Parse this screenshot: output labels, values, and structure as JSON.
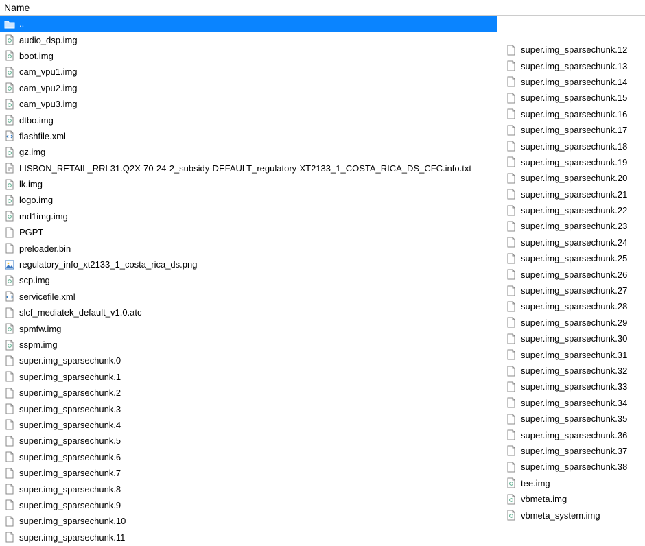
{
  "header": {
    "name_col": "Name"
  },
  "left": [
    {
      "icon": "folder-up",
      "name": "..",
      "selected": true
    },
    {
      "icon": "img",
      "name": "audio_dsp.img"
    },
    {
      "icon": "img",
      "name": "boot.img"
    },
    {
      "icon": "img",
      "name": "cam_vpu1.img"
    },
    {
      "icon": "img",
      "name": "cam_vpu2.img"
    },
    {
      "icon": "img",
      "name": "cam_vpu3.img"
    },
    {
      "icon": "img",
      "name": "dtbo.img"
    },
    {
      "icon": "xml",
      "name": "flashfile.xml"
    },
    {
      "icon": "img",
      "name": "gz.img"
    },
    {
      "icon": "txt",
      "name": "LISBON_RETAIL_RRL31.Q2X-70-24-2_subsidy-DEFAULT_regulatory-XT2133_1_COSTA_RICA_DS_CFC.info.txt"
    },
    {
      "icon": "img",
      "name": "lk.img"
    },
    {
      "icon": "img",
      "name": "logo.img"
    },
    {
      "icon": "img",
      "name": "md1img.img"
    },
    {
      "icon": "file",
      "name": "PGPT"
    },
    {
      "icon": "file",
      "name": "preloader.bin"
    },
    {
      "icon": "png",
      "name": "regulatory_info_xt2133_1_costa_rica_ds.png"
    },
    {
      "icon": "img",
      "name": "scp.img"
    },
    {
      "icon": "xml",
      "name": "servicefile.xml"
    },
    {
      "icon": "file",
      "name": "slcf_mediatek_default_v1.0.atc"
    },
    {
      "icon": "img",
      "name": "spmfw.img"
    },
    {
      "icon": "img",
      "name": "sspm.img"
    },
    {
      "icon": "file",
      "name": "super.img_sparsechunk.0"
    },
    {
      "icon": "file",
      "name": "super.img_sparsechunk.1"
    },
    {
      "icon": "file",
      "name": "super.img_sparsechunk.2"
    },
    {
      "icon": "file",
      "name": "super.img_sparsechunk.3"
    },
    {
      "icon": "file",
      "name": "super.img_sparsechunk.4"
    },
    {
      "icon": "file",
      "name": "super.img_sparsechunk.5"
    },
    {
      "icon": "file",
      "name": "super.img_sparsechunk.6"
    },
    {
      "icon": "file",
      "name": "super.img_sparsechunk.7"
    },
    {
      "icon": "file",
      "name": "super.img_sparsechunk.8"
    },
    {
      "icon": "file",
      "name": "super.img_sparsechunk.9"
    },
    {
      "icon": "file",
      "name": "super.img_sparsechunk.10"
    },
    {
      "icon": "file",
      "name": "super.img_sparsechunk.11"
    }
  ],
  "right": [
    {
      "icon": "file",
      "name": "super.img_sparsechunk.12"
    },
    {
      "icon": "file",
      "name": "super.img_sparsechunk.13"
    },
    {
      "icon": "file",
      "name": "super.img_sparsechunk.14"
    },
    {
      "icon": "file",
      "name": "super.img_sparsechunk.15"
    },
    {
      "icon": "file",
      "name": "super.img_sparsechunk.16"
    },
    {
      "icon": "file",
      "name": "super.img_sparsechunk.17"
    },
    {
      "icon": "file",
      "name": "super.img_sparsechunk.18"
    },
    {
      "icon": "file",
      "name": "super.img_sparsechunk.19"
    },
    {
      "icon": "file",
      "name": "super.img_sparsechunk.20"
    },
    {
      "icon": "file",
      "name": "super.img_sparsechunk.21"
    },
    {
      "icon": "file",
      "name": "super.img_sparsechunk.22"
    },
    {
      "icon": "file",
      "name": "super.img_sparsechunk.23"
    },
    {
      "icon": "file",
      "name": "super.img_sparsechunk.24"
    },
    {
      "icon": "file",
      "name": "super.img_sparsechunk.25"
    },
    {
      "icon": "file",
      "name": "super.img_sparsechunk.26"
    },
    {
      "icon": "file",
      "name": "super.img_sparsechunk.27"
    },
    {
      "icon": "file",
      "name": "super.img_sparsechunk.28"
    },
    {
      "icon": "file",
      "name": "super.img_sparsechunk.29"
    },
    {
      "icon": "file",
      "name": "super.img_sparsechunk.30"
    },
    {
      "icon": "file",
      "name": "super.img_sparsechunk.31"
    },
    {
      "icon": "file",
      "name": "super.img_sparsechunk.32"
    },
    {
      "icon": "file",
      "name": "super.img_sparsechunk.33"
    },
    {
      "icon": "file",
      "name": "super.img_sparsechunk.34"
    },
    {
      "icon": "file",
      "name": "super.img_sparsechunk.35"
    },
    {
      "icon": "file",
      "name": "super.img_sparsechunk.36"
    },
    {
      "icon": "file",
      "name": "super.img_sparsechunk.37"
    },
    {
      "icon": "file",
      "name": "super.img_sparsechunk.38"
    },
    {
      "icon": "img",
      "name": "tee.img"
    },
    {
      "icon": "img",
      "name": "vbmeta.img"
    },
    {
      "icon": "img",
      "name": "vbmeta_system.img"
    }
  ]
}
